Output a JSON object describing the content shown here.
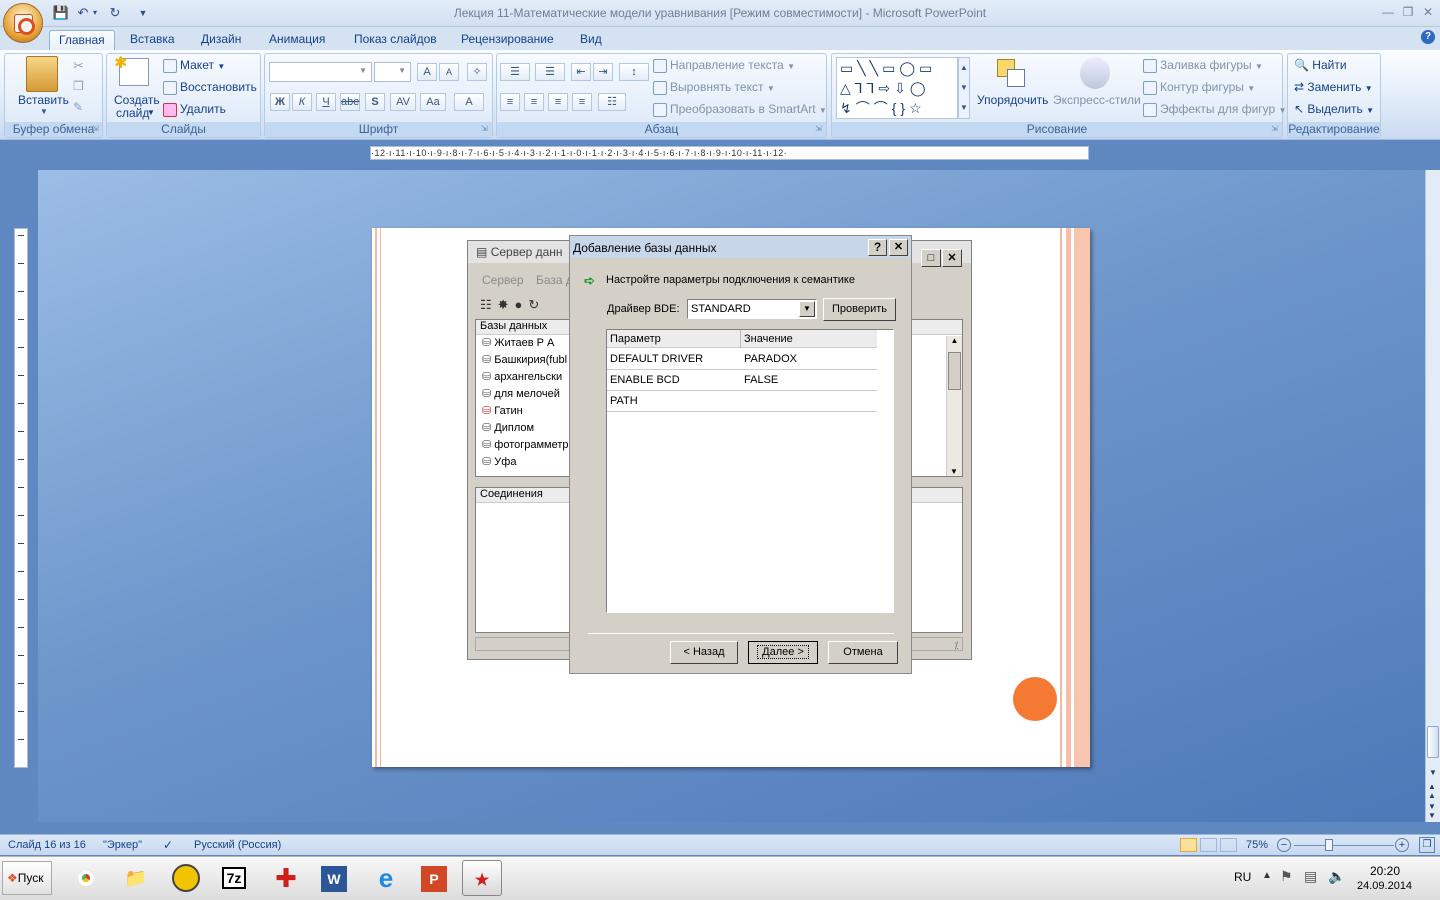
{
  "window": {
    "title": "Лекция  11-Математические модели уравнивания [Режим совместимости] - Microsoft PowerPoint"
  },
  "tabs": [
    "Главная",
    "Вставка",
    "Дизайн",
    "Анимация",
    "Показ слайдов",
    "Рецензирование",
    "Вид"
  ],
  "ribbon": {
    "clipboard": {
      "label": "Буфер обмена",
      "paste": "Вставить"
    },
    "slides": {
      "label": "Слайды",
      "new_slide_1": "Создать",
      "new_slide_2": "слайд",
      "layout": "Макет",
      "reset": "Восстановить",
      "delete": "Удалить"
    },
    "font": {
      "label": "Шрифт",
      "bold": "Ж",
      "italic": "К",
      "underline": "Ч",
      "strike": "abe",
      "shadow": "S",
      "spacing": "AV",
      "case": "Aa",
      "color": "A",
      "grow": "A",
      "shrink": "A"
    },
    "paragraph": {
      "label": "Абзац",
      "direction": "Направление текста",
      "align": "Выровнять текст",
      "smartart": "Преобразовать в SmartArt"
    },
    "drawing": {
      "label": "Рисование",
      "arrange": "Упорядочить",
      "styles": "Экспресс-стили",
      "fill": "Заливка фигуры",
      "outline": "Контур фигуры",
      "effects": "Эффекты для фигур"
    },
    "editing": {
      "label": "Редактирование",
      "find": "Найти",
      "replace": "Заменить",
      "select": "Выделить"
    }
  },
  "ruler": "·12·ı·11·ı·10·ı·9·ı·8·ı·7·ı·6·ı·5·ı·4·ı·3·ı·2·ı·1·ı·0·ı·1·ı·2·ı·3·ı·4·ı·5·ı·6·ı·7·ı·8·ı·9·ı·10·ı·11·ı·12·",
  "server_window": {
    "title": "Сервер данн",
    "menu": [
      "Сервер",
      "База д"
    ],
    "databases_header": "Базы данных",
    "databases": [
      "Житаев Р А",
      "Башкирия(fubl",
      "архангельски",
      "для мелочей",
      "Гатин",
      "Диплом",
      "фотограмметр",
      "Уфа"
    ],
    "connections_header": "Соединения"
  },
  "dialog": {
    "title": "Добавление базы данных",
    "help": "?",
    "close": "✕",
    "instruction": "Настройте параметры подключения к семантике",
    "driver_label": "Драйвер BDE:",
    "driver_value": "STANDARD",
    "check_button": "Проверить",
    "columns": [
      "Параметр",
      "Значение"
    ],
    "rows": [
      {
        "param": "DEFAULT DRIVER",
        "value": "PARADOX"
      },
      {
        "param": "ENABLE BCD",
        "value": "FALSE"
      },
      {
        "param": "PATH",
        "value": ""
      }
    ],
    "back": "< Назад",
    "next": "Далее >",
    "cancel": "Отмена"
  },
  "status": {
    "slide": "Слайд 16 из 16",
    "theme": "\"Эркер\"",
    "lang": "Русский (Россия)",
    "zoom": "75%"
  },
  "taskbar": {
    "start": "Пуск",
    "lang": "RU",
    "time": "20:20",
    "date": "24.09.2014"
  }
}
